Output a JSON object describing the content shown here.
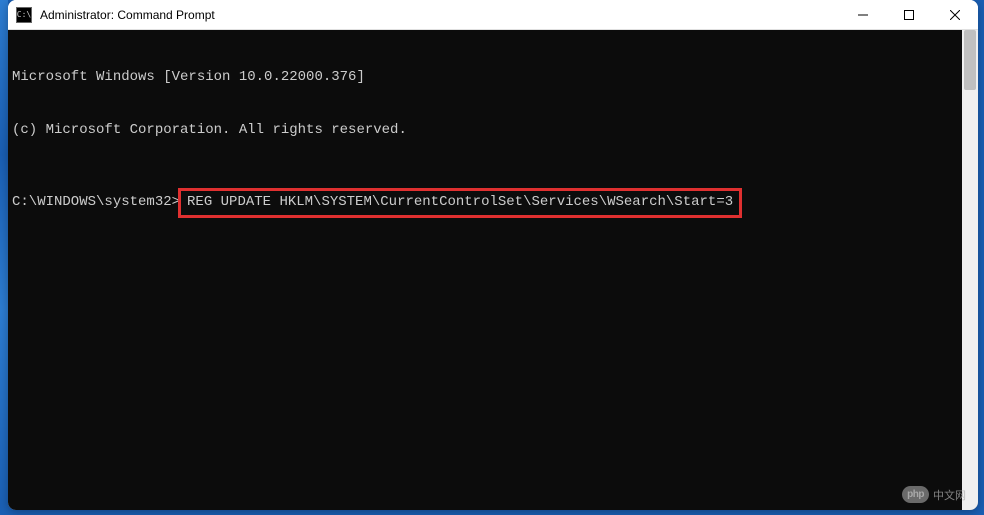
{
  "window": {
    "title": "Administrator: Command Prompt",
    "icon_label": "C:\\"
  },
  "terminal": {
    "line1": "Microsoft Windows [Version 10.0.22000.376]",
    "line2": "(c) Microsoft Corporation. All rights reserved.",
    "prompt": "C:\\WINDOWS\\system32>",
    "command": "REG UPDATE HKLM\\SYSTEM\\CurrentControlSet\\Services\\WSearch\\Start=3"
  },
  "watermark": {
    "badge": "php",
    "text": "中文网"
  },
  "highlight_color": "#e03030"
}
